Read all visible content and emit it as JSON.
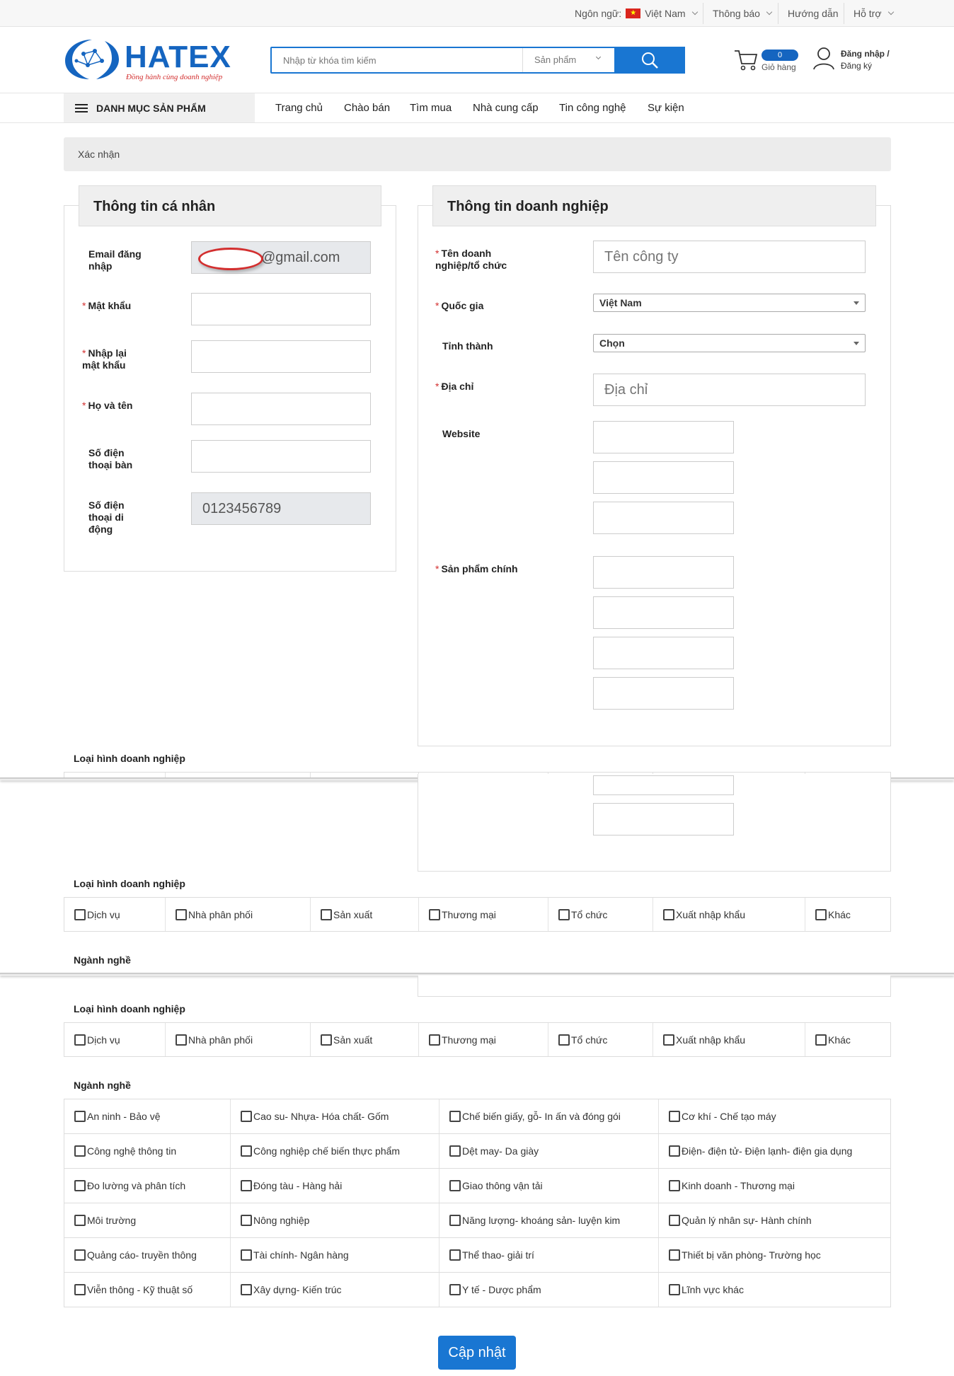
{
  "topbar": {
    "language_label": "Ngôn ngữ:",
    "language_value": "Việt Nam",
    "notifications": "Thông báo",
    "guide": "Hướng dẫn",
    "support": "Hỗ trợ"
  },
  "header": {
    "logo_text": "HATEX",
    "slogan": "Đồng hành cùng doanh nghiệp",
    "search_placeholder": "Nhập từ khóa tìm kiếm",
    "search_category": "Sản phẩm",
    "cart_count": "0",
    "cart_label": "Giỏ hàng",
    "login": "Đăng nhập /",
    "register": "Đăng ký"
  },
  "nav": {
    "category_button": "DANH MỤC SẢN PHẨM",
    "items": [
      "Trang chủ",
      "Chào bán",
      "Tìm mua",
      "Nhà cung cấp",
      "Tin công nghệ",
      "Sự kiện"
    ]
  },
  "breadcrumb": "Xác nhận",
  "personal": {
    "title": "Thông tin cá nhân",
    "email_label": "Email đăng nhập",
    "email_value": "@gmail.com",
    "password_label": "Mật khẩu",
    "confirm_label": "Nhập lại mật khẩu",
    "name_label": "Họ và tên",
    "phone_label": "Số điện thoại bàn",
    "mobile_label": "Số điện thoại di động",
    "mobile_value": "0123456789"
  },
  "business": {
    "title": "Thông tin doanh nghiệp",
    "company_label": "Tên doanh nghiệp/tổ chức",
    "company_placeholder": "Tên công ty",
    "country_label": "Quốc gia",
    "country_value": "Việt Nam",
    "province_label": "Tỉnh thành",
    "province_value": "Chọn",
    "address_label": "Địa chỉ",
    "address_placeholder": "Địa chỉ",
    "website_label": "Website",
    "products_label": "Sản phẩm chính"
  },
  "business_type": {
    "title": "Loại hình doanh nghiệp",
    "options": [
      "Dịch vụ",
      "Nhà phân phối",
      "Sản xuất",
      "Thương mại",
      "Tổ chức",
      "Xuất nhập khẩu",
      "Khác"
    ]
  },
  "industry": {
    "title": "Ngành nghề",
    "options": [
      [
        "An ninh - Bảo vệ",
        "Cao su- Nhựa- Hóa chất- Gốm",
        "Chế biến giấy, gỗ- In ấn và đóng gói",
        "Cơ khí - Chế tạo máy"
      ],
      [
        "Công nghệ thông tin",
        "Công nghiệp chế biến thực phẩm",
        "Dệt may- Da giày",
        "Điện- điện tử- Điện lạnh- điện gia dụng"
      ],
      [
        "Đo lường và phân tích",
        "Đóng tàu - Hàng hải",
        "Giao thông vận tải",
        "Kinh doanh - Thương mại"
      ],
      [
        "Môi trường",
        "Nông nghiệp",
        "Năng lượng- khoáng sản- luyện kim",
        "Quản lý nhân sự- Hành chính"
      ],
      [
        "Quảng cáo- truyền thông",
        "Tài chính- Ngân hàng",
        "Thể thao- giải trí",
        "Thiết bị văn phòng- Trường học"
      ],
      [
        "Viễn thông - Kỹ thuật số",
        "Xây dựng- Kiến trúc",
        "Y tế - Dược phẩm",
        "Lĩnh vực khác"
      ]
    ]
  },
  "submit_label": "Cập nhật",
  "colors": {
    "brand": "#1976d2",
    "required": "#d32f2f"
  }
}
